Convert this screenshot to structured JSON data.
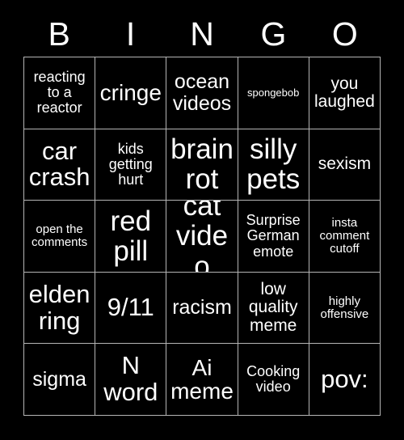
{
  "card": {
    "title": "BINGO",
    "background_color": "#000000",
    "text_color": "#ffffff",
    "border_color": "#b5b5b5"
  },
  "header": {
    "letters": [
      "B",
      "I",
      "N",
      "G",
      "O"
    ]
  },
  "grid": {
    "columns": 5,
    "rows": 5,
    "cells": [
      {
        "text": "reacting\nto a\nreactor",
        "size": "fs-xs"
      },
      {
        "text": "cringe",
        "size": "fs-lg"
      },
      {
        "text": "ocean\nvideos",
        "size": "fs-md"
      },
      {
        "text": "spongebob",
        "size": "fs-tiny"
      },
      {
        "text": "you\nlaughed",
        "size": "fs-sm"
      },
      {
        "text": "car\ncrash",
        "size": "fs-xl"
      },
      {
        "text": "kids\ngetting\nhurt",
        "size": "fs-xs"
      },
      {
        "text": "brain\nrot",
        "size": "fs-xxl"
      },
      {
        "text": "silly\npets",
        "size": "fs-xxl"
      },
      {
        "text": "sexism",
        "size": "fs-sm"
      },
      {
        "text": "open the\ncomments",
        "size": "fs-xxs"
      },
      {
        "text": "red\npill",
        "size": "fs-xxl"
      },
      {
        "text": "cat\nvideo",
        "size": "fs-xxl"
      },
      {
        "text": "Surprise\nGerman\nemote",
        "size": "fs-xs"
      },
      {
        "text": "insta\ncomment\ncutoff",
        "size": "fs-xxs"
      },
      {
        "text": "elden\nring",
        "size": "fs-xl"
      },
      {
        "text": "9/11",
        "size": "fs-xl"
      },
      {
        "text": "racism",
        "size": "fs-md"
      },
      {
        "text": "low\nquality\nmeme",
        "size": "fs-sm"
      },
      {
        "text": "highly\noffensive",
        "size": "fs-xxs"
      },
      {
        "text": "sigma",
        "size": "fs-md"
      },
      {
        "text": "N\nword",
        "size": "fs-xl"
      },
      {
        "text": "Ai\nmeme",
        "size": "fs-lg"
      },
      {
        "text": "Cooking\nvideo",
        "size": "fs-xs"
      },
      {
        "text": "pov:",
        "size": "fs-xl"
      }
    ]
  }
}
